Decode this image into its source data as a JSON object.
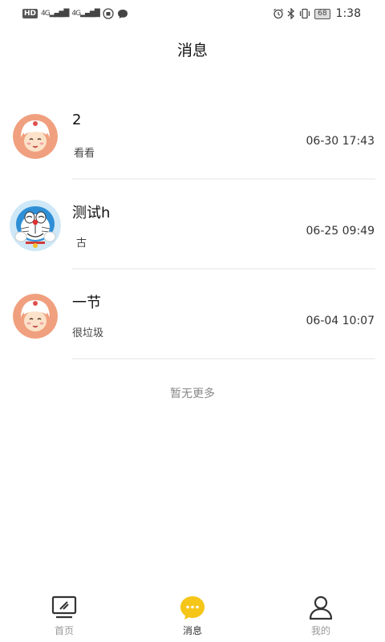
{
  "status_bar": {
    "hd": "HD",
    "sim1": "4G",
    "sim2": "4G",
    "battery": "68",
    "time": "1:38"
  },
  "header": {
    "title": "消息"
  },
  "messages": [
    {
      "name": "2",
      "preview": "看看",
      "time": "06-30 17:43",
      "avatar": "cartoon-girl"
    },
    {
      "name": "测试h",
      "preview": "古",
      "time": "06-25 09:49",
      "avatar": "doraemon"
    },
    {
      "name": "一节",
      "preview": "很垃圾",
      "time": "06-04 10:07",
      "avatar": "cartoon-girl"
    }
  ],
  "footer": {
    "no_more": "暂无更多"
  },
  "tabs": [
    {
      "label": "首页",
      "icon": "monitor-icon"
    },
    {
      "label": "消息",
      "icon": "chat-bubble-icon",
      "active": true
    },
    {
      "label": "我的",
      "icon": "user-icon"
    }
  ],
  "colors": {
    "accent": "#f5c518",
    "active_tab_icon": "#f5c518",
    "inactive_tab_label": "#999999"
  }
}
